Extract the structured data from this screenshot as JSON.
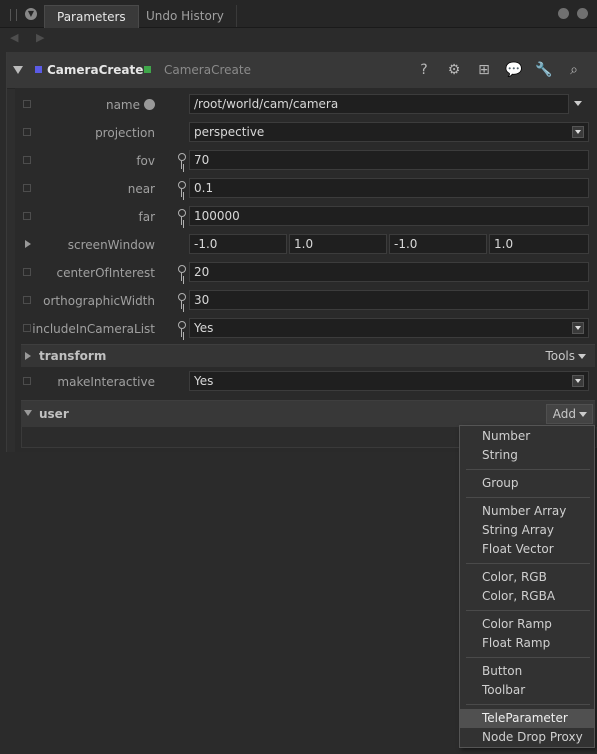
{
  "tabs": {
    "active": "Parameters",
    "inactive": "Undo History"
  },
  "node": {
    "name": "CameraCreate",
    "type": "CameraCreate",
    "name_swatch": "#5b5be6",
    "type_swatch": "#3fa64a"
  },
  "params": {
    "name": {
      "label": "name",
      "value": "/root/world/cam/camera"
    },
    "projection": {
      "label": "projection",
      "value": "perspective"
    },
    "fov": {
      "label": "fov",
      "value": "70"
    },
    "near": {
      "label": "near",
      "value": "0.1"
    },
    "far": {
      "label": "far",
      "value": "100000"
    },
    "screenWindow": {
      "label": "screenWindow",
      "values": [
        "-1.0",
        "1.0",
        "-1.0",
        "1.0"
      ]
    },
    "centerOfInterest": {
      "label": "centerOfInterest",
      "value": "20"
    },
    "orthographicWidth": {
      "label": "orthographicWidth",
      "value": "30"
    },
    "includeInCameraList": {
      "label": "includeInCameraList",
      "value": "Yes"
    },
    "makeInteractive": {
      "label": "makeInteractive",
      "value": "Yes"
    }
  },
  "groups": {
    "transform": {
      "label": "transform",
      "button": "Tools"
    },
    "user": {
      "label": "user",
      "button": "Add"
    }
  },
  "add_menu": {
    "sections": [
      [
        "Number",
        "String"
      ],
      [
        "Group"
      ],
      [
        "Number Array",
        "String Array",
        "Float Vector"
      ],
      [
        "Color, RGB",
        "Color, RGBA"
      ],
      [
        "Color Ramp",
        "Float Ramp"
      ],
      [
        "Button",
        "Toolbar"
      ],
      [
        "TeleParameter",
        "Node Drop Proxy"
      ]
    ],
    "highlighted": "TeleParameter"
  }
}
